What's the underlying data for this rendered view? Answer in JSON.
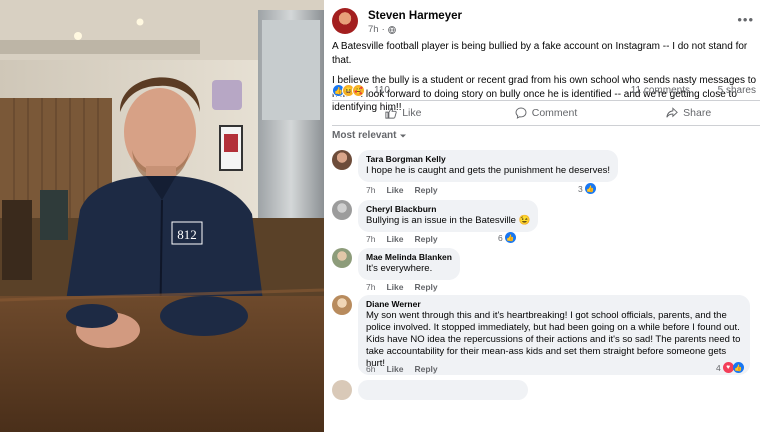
{
  "post": {
    "author": "Steven Harmeyer",
    "time": "7h",
    "separator": "·",
    "paragraphs": [
      "A Batesville football player is being bullied by a fake account on Instagram -- I do not stand for that.",
      "I believe the bully is a student or recent grad from his own school who sends nasty messages to him -- I look forward to doing story on bully once he is identified -- and we're getting close to identifying him!!"
    ],
    "reaction_count": "110",
    "comments_count": "11 comments",
    "shares_count": "5 shares",
    "more_icon": "more-horizontal-icon"
  },
  "actions": {
    "like": "Like",
    "comment": "Comment",
    "share": "Share"
  },
  "sort_label": "Most relevant",
  "comments": [
    {
      "name": "Tara Borgman Kelly",
      "text": "I hope he is caught and gets the punishment he deserves!",
      "time": "7h",
      "like": "Like",
      "reply": "Reply",
      "reactions": "3"
    },
    {
      "name": "Cheryl Blackburn",
      "text": "Bullying is an issue in the Batesville 😉",
      "time": "7h",
      "like": "Like",
      "reply": "Reply",
      "reactions": "6"
    },
    {
      "name": "Mae Melinda Blanken",
      "text": "It's everywhere.",
      "time": "7h",
      "like": "Like",
      "reply": "Reply",
      "reactions": ""
    },
    {
      "name": "Diane Werner",
      "text": "My son went through this and it's heartbreaking! I got school officials, parents, and the police involved. It stopped immediately, but had been going on a while before I found out. Kids have NO idea the repercussions of their actions and it's so sad! The parents need to take accountability for their mean-ass kids and set them straight before someone gets hurt!",
      "time": "6h",
      "like": "Like",
      "reply": "Reply",
      "reactions": "4"
    }
  ],
  "photo": {
    "jacket_text": "812",
    "accent_colors": {
      "jacket": "#1d2a44",
      "wood": "#8a5a34",
      "wall": "#e9e3d6"
    }
  },
  "colors": {
    "brand": "#1877f2",
    "muted": "#65676b",
    "bubble": "#f0f2f5",
    "divider": "#ced0d4"
  }
}
